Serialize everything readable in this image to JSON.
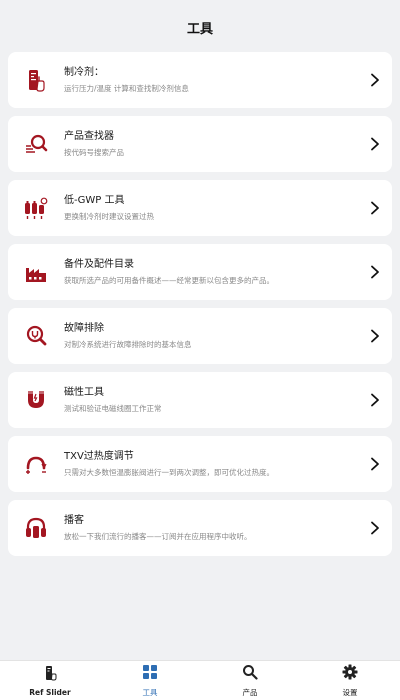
{
  "header": {
    "title": "工具"
  },
  "colors": {
    "brand_red": "#a31621",
    "active_blue": "#2d6db3",
    "background": "#f0f1f3"
  },
  "tools": [
    {
      "icon": "refrigerant-gauge-icon",
      "title": "制冷剂：",
      "desc": "运行压力/温度 计算和查找制冷剂信息"
    },
    {
      "icon": "search-icon",
      "title": "产品查找器",
      "desc": "按代码号搜索产品"
    },
    {
      "icon": "low-gwp-cylinders-icon",
      "title": "低-GWP 工具",
      "desc": "更换制冷剂时建议设置过热"
    },
    {
      "icon": "factory-icon",
      "title": "备件及配件目录",
      "desc": "获取所选产品的可用备件概述——经常更新以包含更多的产品。"
    },
    {
      "icon": "troubleshoot-icon",
      "title": "故障排除",
      "desc": "对制冷系统进行故障排除时的基本信息"
    },
    {
      "icon": "magnet-icon",
      "title": "磁性工具",
      "desc": "测试和验证电磁线圈工作正常"
    },
    {
      "icon": "txv-adjust-icon",
      "title": "TXV过热度调节",
      "desc": "只需对大多数恒温膨胀阀进行一到两次调整，即可优化过热度。"
    },
    {
      "icon": "headphones-icon",
      "title": "播客",
      "desc": "放松一下我们流行的播客——订阅并在应用程序中收听。"
    }
  ],
  "bottom_nav": [
    {
      "icon": "ref-slider-icon",
      "label": "Ref Slider"
    },
    {
      "icon": "grid-icon",
      "label": "工具",
      "active": true
    },
    {
      "icon": "search-icon",
      "label": "产品"
    },
    {
      "icon": "gear-icon",
      "label": "设置"
    }
  ]
}
